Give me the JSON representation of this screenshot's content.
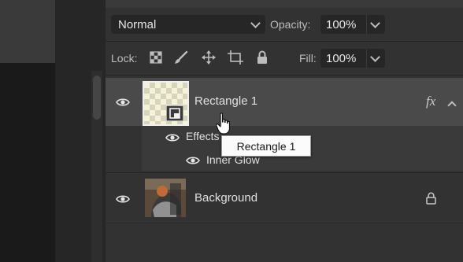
{
  "blend": {
    "mode": "Normal",
    "opacity_label": "Opacity:",
    "opacity_value": "100%"
  },
  "lock": {
    "label": "Lock:",
    "fill_label": "Fill:",
    "fill_value": "100%"
  },
  "layers": [
    {
      "name": "Rectangle 1",
      "fx": "fx",
      "selected": true
    },
    {
      "name": "Effects"
    },
    {
      "name": "Inner Glow"
    },
    {
      "name": "Background",
      "locked": true
    }
  ],
  "tooltip": "Rectangle 1",
  "icons": [
    "eye-icon",
    "checkerboard-lock-icon",
    "brush-lock-icon",
    "move-lock-icon",
    "artboard-lock-icon",
    "padlock-icon",
    "smart-object-icon",
    "fx-icon",
    "chevron-up-icon",
    "mouse-pointer-hand-icon"
  ]
}
